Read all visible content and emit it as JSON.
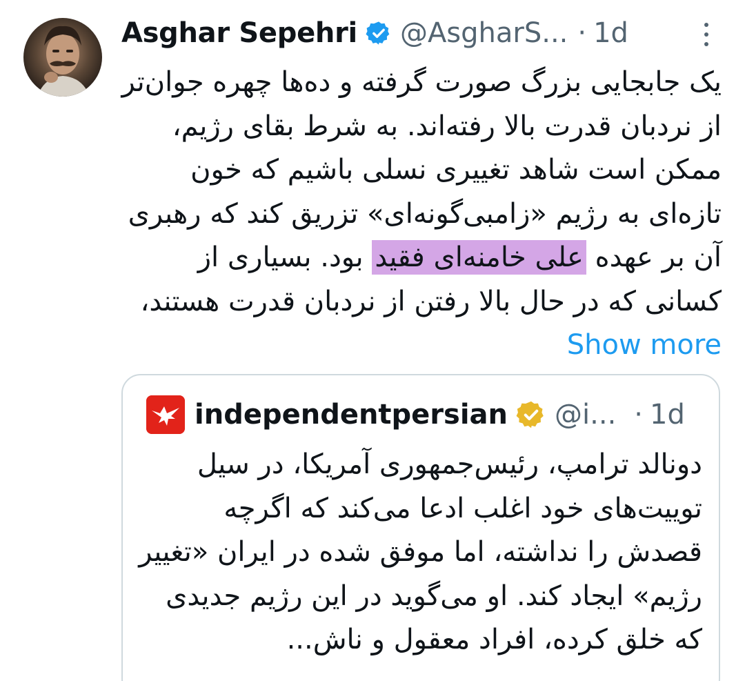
{
  "tweet": {
    "author_name": "Asghar Sepehri",
    "handle": "@AsgharS...",
    "dot": "·",
    "time": "1d",
    "text_before": "یک جابجایی بزرگ صورت گرفته و ده‌ها چهره جوان‌تر از نردبان قدرت بالا رفته‌اند. به شرط بقای رژیم، ممکن است شاهد تغییری نسلی باشیم که خون تازه‌ای به رژیم «زامبی‌گونه‌ای» تزریق کند که رهبری آن بر عهده ",
    "text_highlight": "علی خامنه‌ای فقید",
    "text_after": " بود. بسیاری از کسانی که در حال بالا رفتن از نردبان قدرت هستند، ",
    "show_more": "Show more",
    "verified_color": "#1d9bf0",
    "highlight_color": "#d4a6e6",
    "link_color": "#1d9bf0"
  },
  "quoted": {
    "author_name": "independentpersian",
    "handle": "@i...",
    "dot": "·",
    "time": "1d",
    "text": "دونالد ترامپ، رئیس‌جمهوری آمریکا، در سیل توییت‌های خود اغلب ادعا می‌کند که اگرچه قصدش را نداشته، اما موفق شده در ایران «تغییر رژیم» ایجاد کند. او می‌گوید در این رژیم جدیدی که خلق کرده، افراد معقول و ناش...",
    "logo_color": "#e2231a",
    "verified_color": "#e8b82a"
  }
}
